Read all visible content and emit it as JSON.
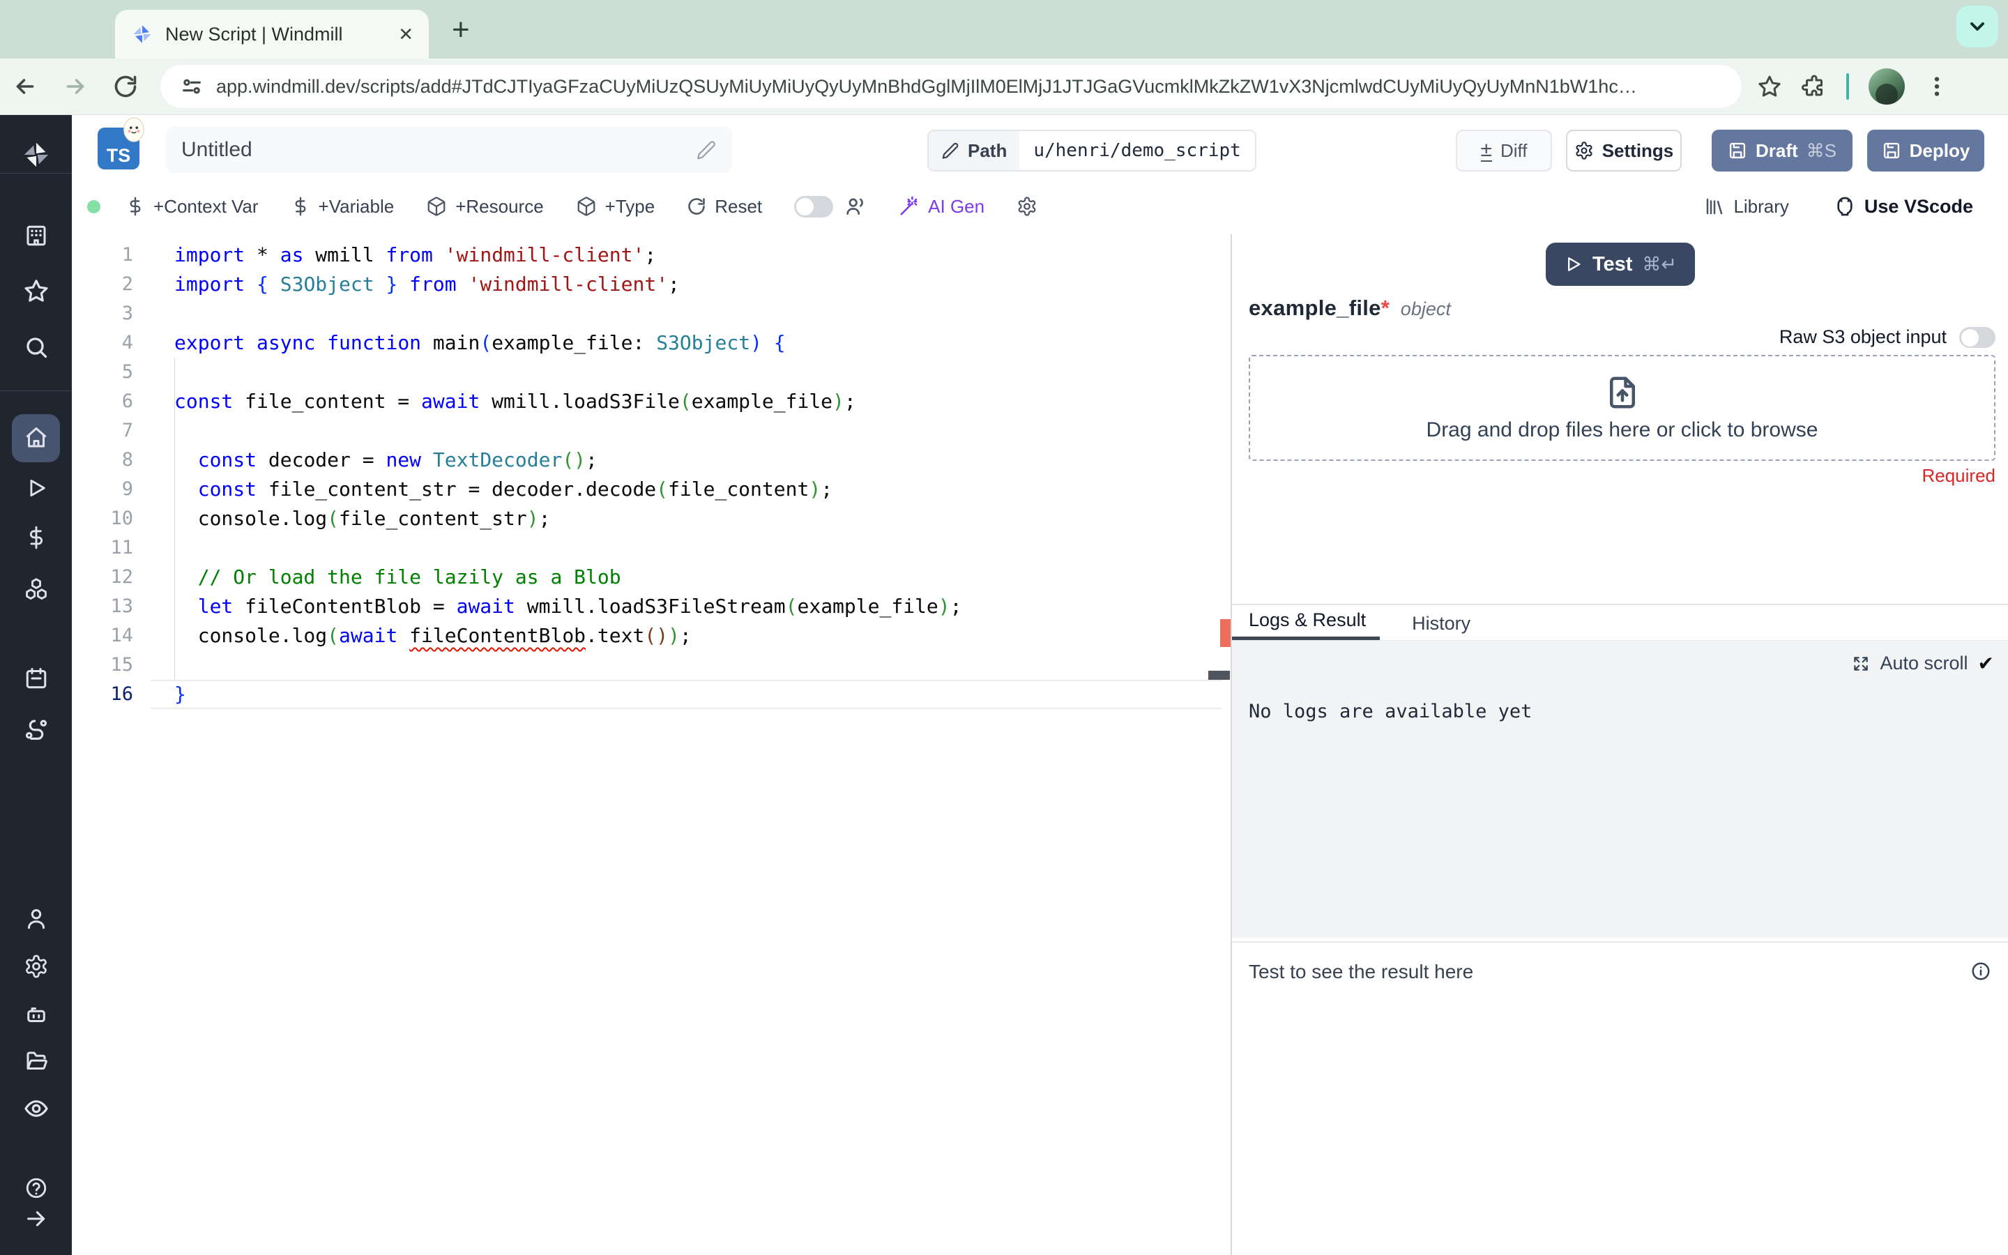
{
  "browser": {
    "tab_title": "New Script | Windmill",
    "close_glyph": "✕",
    "newtab_glyph": "+",
    "url": "app.windmill.dev/scripts/add#JTdCJTIyaGFzaCUyMiUzQSUyMiUyMiUyQyUyMnBhdGglMjIlM0ElMjJ1JTJGaGVucmklMkZkZW1vX3NjcmlwdCUyMiUyQyUyMnN1bW1hc…"
  },
  "header": {
    "lang_badge": "TS",
    "title": "Untitled",
    "path_label": "Path",
    "path_value": "u/henri/demo_script",
    "diff_label": "Diff",
    "diff_glyph": "±",
    "settings_label": "Settings",
    "draft_label": "Draft",
    "draft_shortcut": "⌘S",
    "deploy_label": "Deploy"
  },
  "toolbar": {
    "context_var": "+Context Var",
    "variable": "+Variable",
    "resource": "+Resource",
    "type": "+Type",
    "reset": "Reset",
    "ai_gen": "AI Gen",
    "library": "Library",
    "vscode": "Use VScode"
  },
  "editor": {
    "active_line": 16,
    "lines": [
      {
        "n": 1,
        "segs": [
          [
            "kw",
            "import"
          ],
          [
            "pl",
            " * "
          ],
          [
            "kw",
            "as"
          ],
          [
            "pl",
            " wmill "
          ],
          [
            "kw",
            "from"
          ],
          [
            "pl",
            " "
          ],
          [
            "str",
            "'windmill-client'"
          ],
          [
            "pl",
            ";"
          ]
        ]
      },
      {
        "n": 2,
        "segs": [
          [
            "kw",
            "import"
          ],
          [
            "pl",
            " "
          ],
          [
            "b1",
            "{"
          ],
          [
            "pl",
            " "
          ],
          [
            "ty",
            "S3Object"
          ],
          [
            "pl",
            " "
          ],
          [
            "b1",
            "}"
          ],
          [
            "pl",
            " "
          ],
          [
            "kw",
            "from"
          ],
          [
            "pl",
            " "
          ],
          [
            "str",
            "'windmill-client'"
          ],
          [
            "pl",
            ";"
          ]
        ]
      },
      {
        "n": 3,
        "segs": []
      },
      {
        "n": 4,
        "segs": [
          [
            "kw",
            "export"
          ],
          [
            "pl",
            " "
          ],
          [
            "kw",
            "async"
          ],
          [
            "pl",
            " "
          ],
          [
            "kw",
            "function"
          ],
          [
            "pl",
            " main"
          ],
          [
            "b1",
            "("
          ],
          [
            "pl",
            "example_file: "
          ],
          [
            "ty",
            "S3Object"
          ],
          [
            "b1",
            ")"
          ],
          [
            "pl",
            " "
          ],
          [
            "b1",
            "{"
          ]
        ]
      },
      {
        "n": 5,
        "segs": []
      },
      {
        "n": 6,
        "segs": [
          [
            "kw",
            "const"
          ],
          [
            "pl",
            " file_content = "
          ],
          [
            "kw",
            "await"
          ],
          [
            "pl",
            " wmill.loadS3File"
          ],
          [
            "b2",
            "("
          ],
          [
            "pl",
            "example_file"
          ],
          [
            "b2",
            ")"
          ],
          [
            "pl",
            ";"
          ]
        ]
      },
      {
        "n": 7,
        "segs": []
      },
      {
        "n": 8,
        "segs": [
          [
            "pl",
            "  "
          ],
          [
            "kw",
            "const"
          ],
          [
            "pl",
            " decoder = "
          ],
          [
            "kw",
            "new"
          ],
          [
            "pl",
            " "
          ],
          [
            "ty",
            "TextDecoder"
          ],
          [
            "b2",
            "()"
          ],
          [
            "pl",
            ";"
          ]
        ]
      },
      {
        "n": 9,
        "segs": [
          [
            "pl",
            "  "
          ],
          [
            "kw",
            "const"
          ],
          [
            "pl",
            " file_content_str = decoder.decode"
          ],
          [
            "b2",
            "("
          ],
          [
            "pl",
            "file_content"
          ],
          [
            "b2",
            ")"
          ],
          [
            "pl",
            ";"
          ]
        ]
      },
      {
        "n": 10,
        "segs": [
          [
            "pl",
            "  console.log"
          ],
          [
            "b2",
            "("
          ],
          [
            "pl",
            "file_content_str"
          ],
          [
            "b2",
            ")"
          ],
          [
            "pl",
            ";"
          ]
        ]
      },
      {
        "n": 11,
        "segs": []
      },
      {
        "n": 12,
        "segs": [
          [
            "pl",
            "  "
          ],
          [
            "cm",
            "// Or load the file lazily as a Blob"
          ]
        ]
      },
      {
        "n": 13,
        "segs": [
          [
            "pl",
            "  "
          ],
          [
            "kw",
            "let"
          ],
          [
            "pl",
            " fileContentBlob = "
          ],
          [
            "kw",
            "await"
          ],
          [
            "pl",
            " wmill.loadS3FileStream"
          ],
          [
            "b2",
            "("
          ],
          [
            "pl",
            "example_file"
          ],
          [
            "b2",
            ")"
          ],
          [
            "pl",
            ";"
          ]
        ]
      },
      {
        "n": 14,
        "segs": [
          [
            "pl",
            "  console.log"
          ],
          [
            "b2",
            "("
          ],
          [
            "kw",
            "await"
          ],
          [
            "pl",
            " "
          ],
          [
            "er",
            "fileContentBlob"
          ],
          [
            "pl",
            ".text"
          ],
          [
            "b3",
            "()"
          ],
          [
            "b2",
            ")"
          ],
          [
            "pl",
            ";"
          ]
        ]
      },
      {
        "n": 15,
        "segs": []
      },
      {
        "n": 16,
        "segs": [
          [
            "b1",
            "}"
          ]
        ]
      }
    ]
  },
  "panel": {
    "test_label": "Test",
    "test_shortcut": "⌘↵",
    "arg_name": "example_file",
    "arg_required_mark": "*",
    "arg_type": "object",
    "raw_s3_label": "Raw S3 object input",
    "dropzone_text": "Drag and drop files here or click to browse",
    "required_label": "Required",
    "tabs": [
      "Logs & Result",
      "History"
    ],
    "autoscroll_label": "Auto scroll",
    "autoscroll_check": "✔",
    "no_logs_text": "No logs are available yet",
    "result_placeholder": "Test to see the result here"
  },
  "icons": {
    "sidebar": [
      "windmill-logo",
      "building-icon",
      "star-icon",
      "search-icon",
      "home-icon",
      "play-icon",
      "dollar-icon",
      "cubes-icon",
      "calendar-icon",
      "route-icon",
      "user-icon",
      "gear-icon",
      "robot-icon",
      "folder-icon",
      "eye-icon",
      "help-icon",
      "arrow-right-icon"
    ],
    "colors": {
      "accent_slate": "#64779e",
      "test_navy": "#3a4763",
      "ai_purple": "#7c3aed",
      "status_green": "#84e0a6",
      "error_red": "#dc2626",
      "splitter_red": "#ee6e5e"
    }
  }
}
